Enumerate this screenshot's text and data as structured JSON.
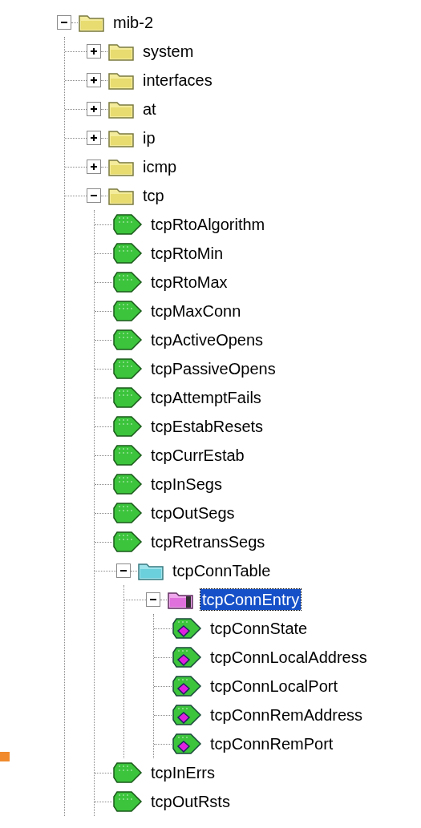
{
  "tree": [
    {
      "label": "mib-2",
      "kind": "folder",
      "expanded": true,
      "selected": false,
      "children": [
        {
          "label": "system",
          "kind": "folder",
          "expanded": false,
          "selected": false
        },
        {
          "label": "interfaces",
          "kind": "folder",
          "expanded": false,
          "selected": false
        },
        {
          "label": "at",
          "kind": "folder",
          "expanded": false,
          "selected": false
        },
        {
          "label": "ip",
          "kind": "folder",
          "expanded": false,
          "selected": false
        },
        {
          "label": "icmp",
          "kind": "folder",
          "expanded": false,
          "selected": false
        },
        {
          "label": "tcp",
          "kind": "folder",
          "expanded": true,
          "selected": false,
          "children": [
            {
              "label": "tcpRtoAlgorithm",
              "kind": "scalar",
              "selected": false
            },
            {
              "label": "tcpRtoMin",
              "kind": "scalar",
              "selected": false
            },
            {
              "label": "tcpRtoMax",
              "kind": "scalar",
              "selected": false
            },
            {
              "label": "tcpMaxConn",
              "kind": "scalar",
              "selected": false
            },
            {
              "label": "tcpActiveOpens",
              "kind": "scalar",
              "selected": false
            },
            {
              "label": "tcpPassiveOpens",
              "kind": "scalar",
              "selected": false
            },
            {
              "label": "tcpAttemptFails",
              "kind": "scalar",
              "selected": false
            },
            {
              "label": "tcpEstabResets",
              "kind": "scalar",
              "selected": false
            },
            {
              "label": "tcpCurrEstab",
              "kind": "scalar",
              "selected": false
            },
            {
              "label": "tcpInSegs",
              "kind": "scalar",
              "selected": false
            },
            {
              "label": "tcpOutSegs",
              "kind": "scalar",
              "selected": false
            },
            {
              "label": "tcpRetransSegs",
              "kind": "scalar",
              "selected": false
            },
            {
              "label": "tcpConnTable",
              "kind": "table",
              "expanded": true,
              "selected": false,
              "children": [
                {
                  "label": "tcpConnEntry",
                  "kind": "entry",
                  "expanded": true,
                  "selected": true,
                  "children": [
                    {
                      "label": "tcpConnState",
                      "kind": "column",
                      "selected": false
                    },
                    {
                      "label": "tcpConnLocalAddress",
                      "kind": "column",
                      "selected": false
                    },
                    {
                      "label": "tcpConnLocalPort",
                      "kind": "column",
                      "selected": false
                    },
                    {
                      "label": "tcpConnRemAddress",
                      "kind": "column",
                      "selected": false
                    },
                    {
                      "label": "tcpConnRemPort",
                      "kind": "column",
                      "selected": false
                    }
                  ]
                }
              ]
            },
            {
              "label": "tcpInErrs",
              "kind": "scalar",
              "selected": false
            },
            {
              "label": "tcpOutRsts",
              "kind": "scalar",
              "selected": false
            }
          ]
        }
      ]
    }
  ]
}
